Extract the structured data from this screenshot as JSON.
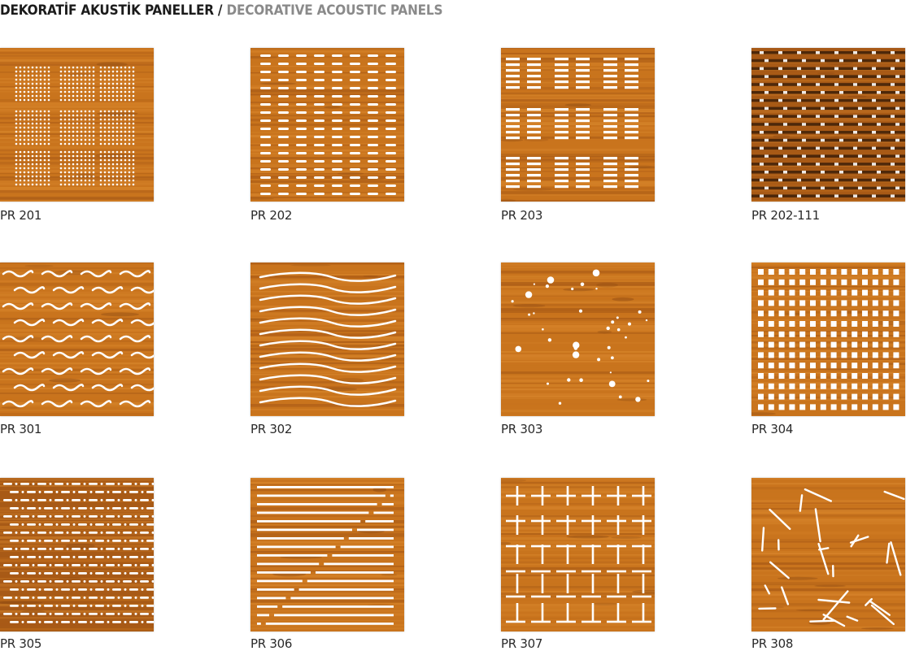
{
  "header": {
    "title_tr": "DEKORATİF AKUSTİK PANELLER /",
    "title_en": "DECORATIVE ACOUSTIC PANELS"
  },
  "colors": {
    "wood_light": "#d8862c",
    "wood_mid": "#c9741d",
    "wood_dark": "#a85a16",
    "wood_deep": "#7a3d10",
    "perforation": "#ffffff"
  },
  "panels": [
    {
      "code": "PR 201",
      "pattern": "dot-grid-blocks"
    },
    {
      "code": "PR 202",
      "pattern": "short-dashes"
    },
    {
      "code": "PR 203",
      "pattern": "slot-blocks"
    },
    {
      "code": "PR 202-111",
      "pattern": "dark-line-rows"
    },
    {
      "code": "PR 301",
      "pattern": "short-waves"
    },
    {
      "code": "PR 302",
      "pattern": "long-waves"
    },
    {
      "code": "PR 303",
      "pattern": "scattered-dots"
    },
    {
      "code": "PR 304",
      "pattern": "square-grid"
    },
    {
      "code": "PR 305",
      "pattern": "dash-dot-rows"
    },
    {
      "code": "PR 306",
      "pattern": "diagonal-lines"
    },
    {
      "code": "PR 307",
      "pattern": "cross-grid"
    },
    {
      "code": "PR 308",
      "pattern": "random-sticks"
    }
  ]
}
